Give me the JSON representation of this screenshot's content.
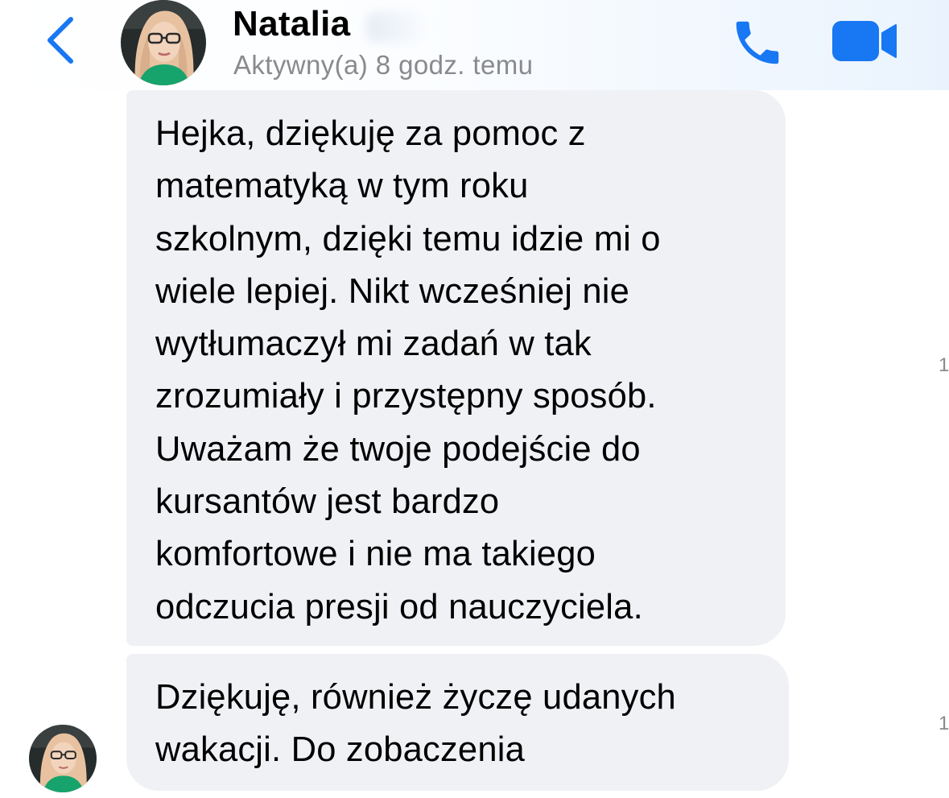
{
  "header": {
    "contact_name": "Natalia",
    "status": "Aktywny(a) 8 godz. temu",
    "back_icon": "chevron-left-icon",
    "call_icon": "phone-icon",
    "video_icon": "video-camera-icon"
  },
  "messages": [
    {
      "text": "Hejka, dziękuję za pomoc z\nmatematyką w tym roku\nszkolnym, dzięki temu idzie mi o\nwiele lepiej. Nikt wcześniej nie\nwytłumaczył mi zadań w tak\nzrozumiały i przystępny sposób.\nUważam że twoje podejście do\nkursantów jest bardzo\nkomfortowe i nie ma takiego\nodczucia presji od nauczyciela.",
      "side_marker": "1"
    },
    {
      "text": "Dziękuję, również życzę udanych\nwakacji. Do zobaczenia",
      "side_marker": "1"
    }
  ],
  "colors": {
    "accent": "#1877f2",
    "bubble_bg": "#f0f1f5",
    "status_text": "#8a8a8e"
  }
}
